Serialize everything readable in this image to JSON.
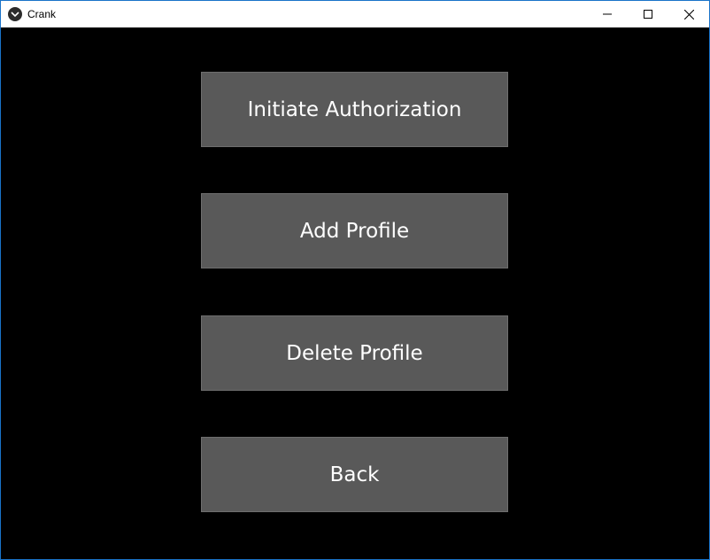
{
  "window": {
    "title": "Crank",
    "icon": "app-logo-icon",
    "controls": [
      "minimize-icon",
      "maximize-icon",
      "close-icon"
    ]
  },
  "menu": {
    "buttons": [
      {
        "label": "Initiate Authorization"
      },
      {
        "label": "Add Profile"
      },
      {
        "label": "Delete Profile"
      },
      {
        "label": "Back"
      }
    ]
  },
  "colors": {
    "background": "#000000",
    "button": "#595959",
    "button_text": "#ffffff",
    "window_border": "#1a73c9"
  }
}
